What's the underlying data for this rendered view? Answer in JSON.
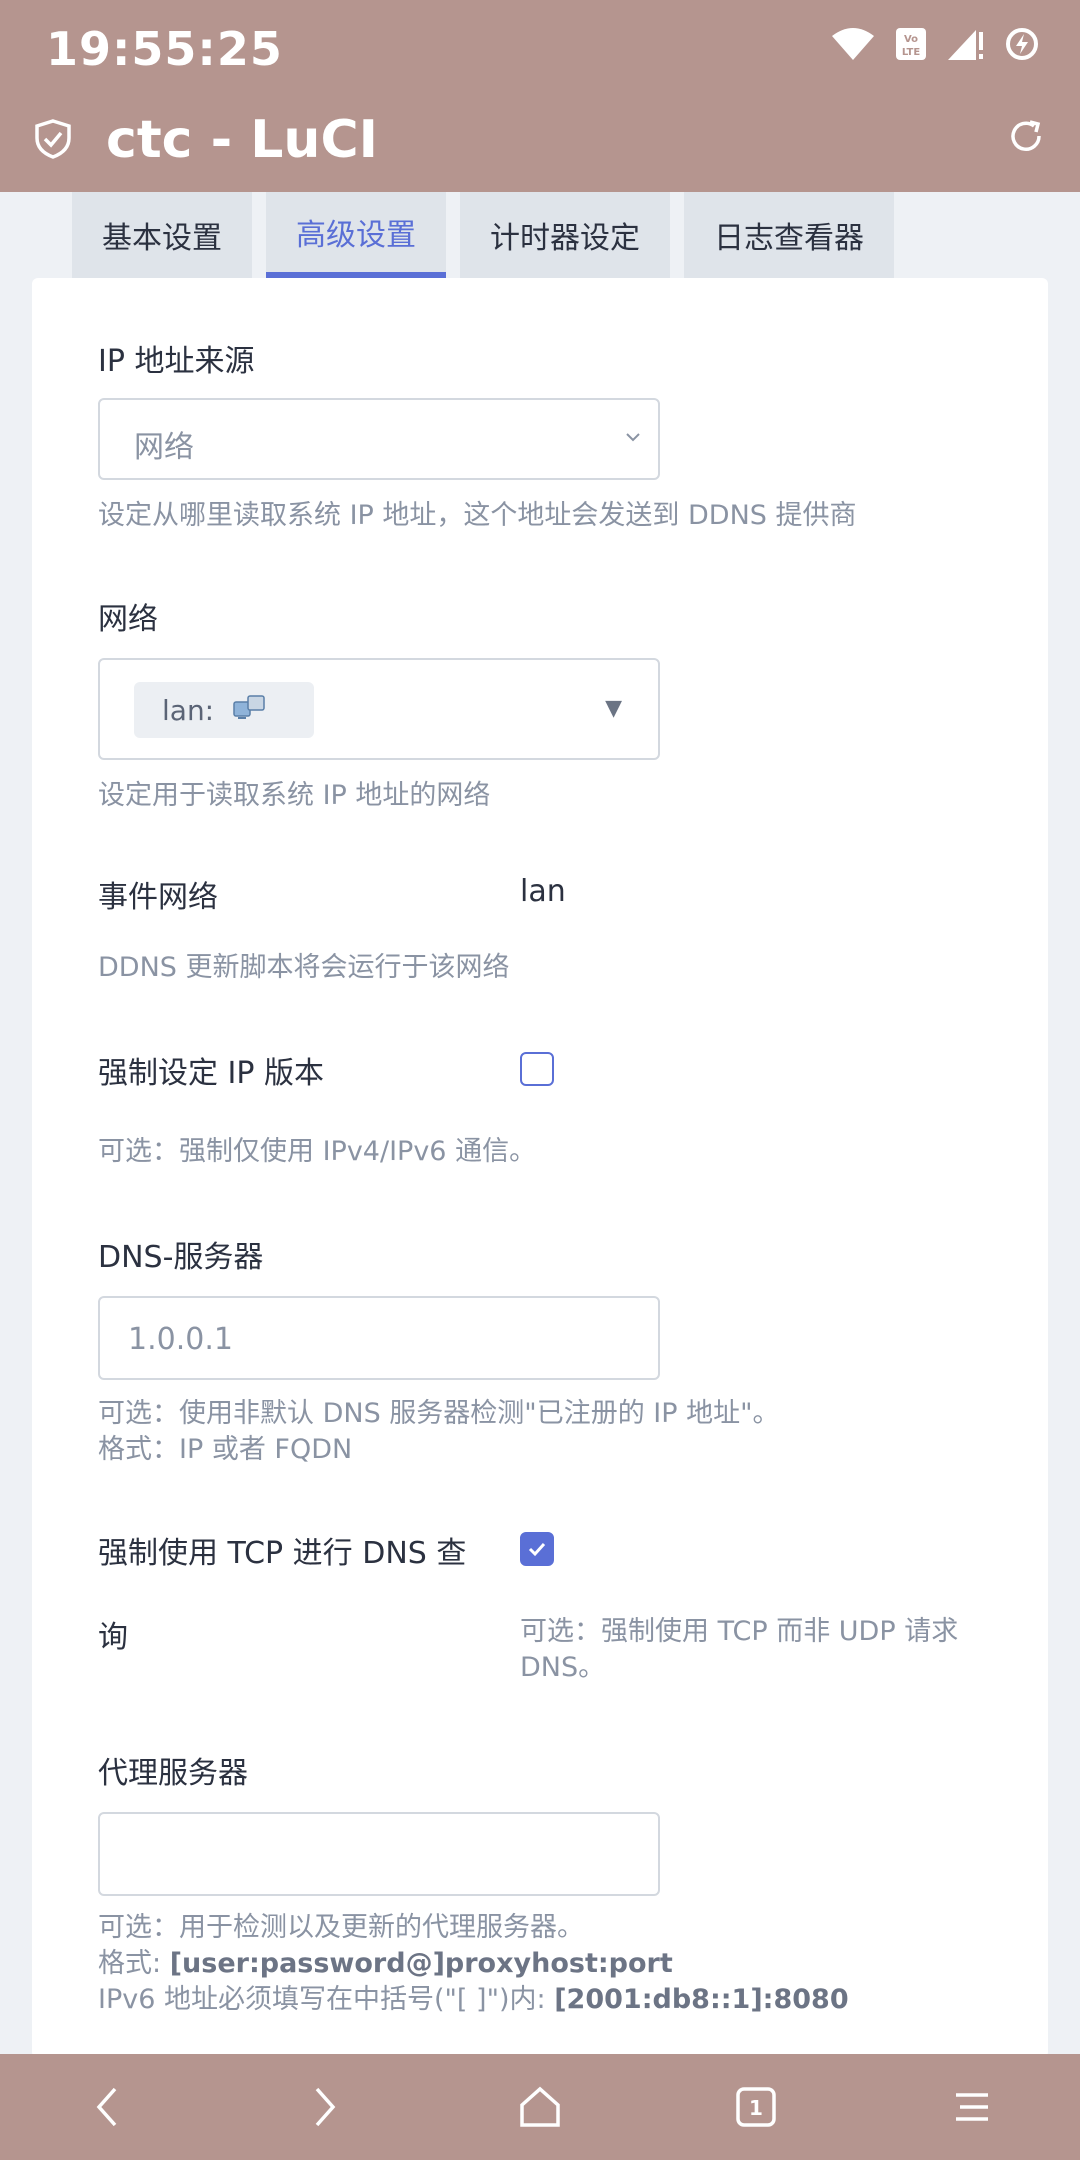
{
  "status": {
    "time": "19:55:25"
  },
  "app": {
    "title": "ctc - LuCI"
  },
  "tabs": [
    {
      "label": "基本设置",
      "active": false
    },
    {
      "label": "高级设置",
      "active": true
    },
    {
      "label": "计时器设定",
      "active": false
    },
    {
      "label": "日志查看器",
      "active": false
    }
  ],
  "form": {
    "ip_source": {
      "label": "IP 地址来源",
      "value": "网络",
      "help": "设定从哪里读取系统 IP 地址，这个地址会发送到 DDNS 提供商"
    },
    "network": {
      "label": "网络",
      "chip": "lan:",
      "help": "设定用于读取系统 IP 地址的网络"
    },
    "event_network": {
      "label": "事件网络",
      "value": "lan",
      "help": "DDNS 更新脚本将会运行于该网络"
    },
    "force_ip_version": {
      "label": "强制设定 IP 版本",
      "checked": false,
      "help": "可选：强制仅使用 IPv4/IPv6 通信。"
    },
    "dns_server": {
      "label": "DNS-服务器",
      "placeholder": "1.0.0.1",
      "help_line1": "可选：使用非默认 DNS 服务器检测\"已注册的 IP 地址\"。",
      "help_line2": "格式：IP 或者 FQDN"
    },
    "force_tcp": {
      "label_line1": "强制使用 TCP 进行 DNS 查",
      "label_line2": "询",
      "checked": true,
      "help_line1": "可选：强制使用 TCP 而非 UDP 请求",
      "help_line2": "DNS。"
    },
    "proxy": {
      "label": "代理服务器",
      "value": "",
      "help_line1": "可选：用于检测以及更新的代理服务器。",
      "help_line2_prefix": "格式: ",
      "help_line2_bold": "[user:password@]proxyhost:port",
      "help_line3_prefix": "IPv6 地址必须填写在中括号(\"[ ]\")内: ",
      "help_line3_bold": "[2001:db8::1]:8080"
    }
  },
  "colors": {
    "topbar": "#b5958f",
    "accent": "#5a6fd6"
  },
  "nav": {
    "tab_count": "1"
  }
}
